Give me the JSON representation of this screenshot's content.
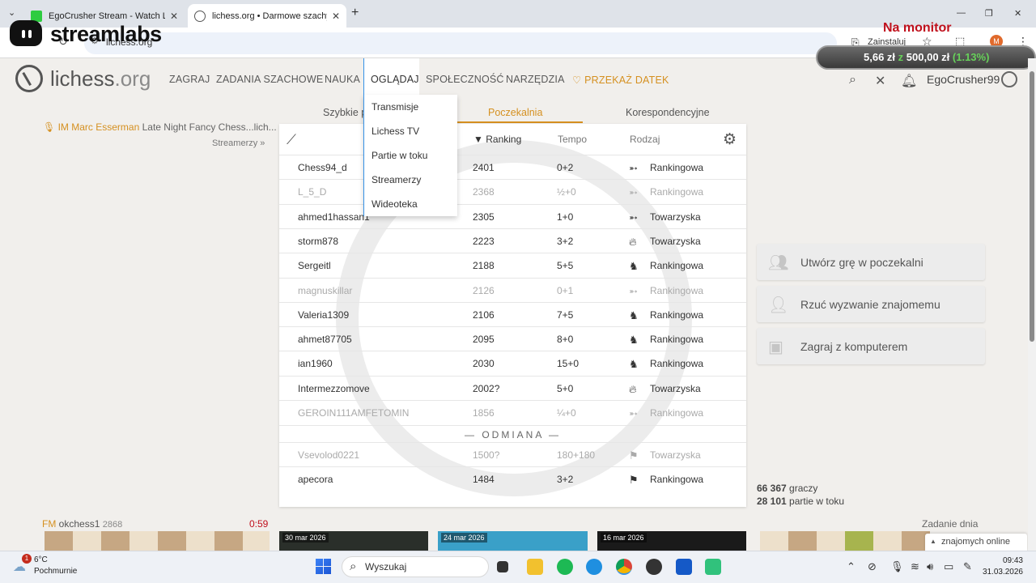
{
  "browser": {
    "tabs": [
      {
        "title": "EgoCrusher Stream - Watch Liv",
        "favicon_color": "#2ecc40"
      },
      {
        "title": "lichess.org • Darmowe szachy o",
        "favicon_color": "#555555"
      }
    ],
    "url": "lichess.org",
    "install_label": "Zainstaluj",
    "profile_initial": "M"
  },
  "overlay": {
    "brand": "streamlabs",
    "monitor_label": "Na monitor",
    "goal_current": "5,66 zł",
    "goal_sep": "z",
    "goal_target": "500,00 zł",
    "goal_percent": "(1.13%)"
  },
  "site": {
    "logo_main": "lichess",
    "logo_suffix": ".org",
    "nav": [
      "ZAGRAJ",
      "ZADANIA SZACHOWE",
      "NAUKA",
      "OGLĄDAJ",
      "SPOŁECZNOŚĆ",
      "NARZĘDZIA"
    ],
    "donate": "PRZEKAŻ DATEK",
    "username": "EgoCrusher99"
  },
  "watch_menu": [
    "Transmisje",
    "Lichess TV",
    "Partie w toku",
    "Streamerzy",
    "Wideoteka"
  ],
  "streamer": {
    "name": "IM Marc Esserman",
    "title": "Late Night Fancy Chess...lich...",
    "link": "Streamerzy »"
  },
  "lobby_tabs": [
    "Szybkie p",
    "Poczekalnia",
    "Korespondencyjne"
  ],
  "lobby": {
    "headers": {
      "rating": "Ranking",
      "time": "Tempo",
      "mode": "Rodzaj"
    },
    "rows": [
      {
        "name": "Chess94_d",
        "rating": "2401",
        "time": "0+2",
        "mode": "Rankingowa",
        "icon": "bullet",
        "dim": false
      },
      {
        "name": "L_5_D",
        "rating": "2368",
        "time": "½+0",
        "mode": "Rankingowa",
        "icon": "bullet",
        "dim": true
      },
      {
        "name": "ahmed1hassan1",
        "rating": "2305",
        "time": "1+0",
        "mode": "Towarzyska",
        "icon": "bullet",
        "dim": false
      },
      {
        "name": "storm878",
        "rating": "2223",
        "time": "3+2",
        "mode": "Towarzyska",
        "icon": "blitz",
        "dim": false
      },
      {
        "name": "Sergeitl",
        "rating": "2188",
        "time": "5+5",
        "mode": "Rankingowa",
        "icon": "rapid",
        "dim": false
      },
      {
        "name": "magnuskillar",
        "rating": "2126",
        "time": "0+1",
        "mode": "Rankingowa",
        "icon": "bullet",
        "dim": true
      },
      {
        "name": "Valeria1309",
        "rating": "2106",
        "time": "7+5",
        "mode": "Rankingowa",
        "icon": "rapid",
        "dim": false
      },
      {
        "name": "ahmet87705",
        "rating": "2095",
        "time": "8+0",
        "mode": "Rankingowa",
        "icon": "rapid",
        "dim": false
      },
      {
        "name": "ian1960",
        "rating": "2030",
        "time": "15+0",
        "mode": "Rankingowa",
        "icon": "rapid",
        "dim": false
      },
      {
        "name": "Intermezzomove",
        "rating": "2002?",
        "time": "5+0",
        "mode": "Towarzyska",
        "icon": "blitz",
        "dim": false
      },
      {
        "name": "GEROIN111AMFETOMIN",
        "rating": "1856",
        "time": "¼+0",
        "mode": "Rankingowa",
        "icon": "bullet",
        "dim": true
      }
    ],
    "separator": "— ODMIANA —",
    "variant_rows": [
      {
        "name": "Vsevolod0221",
        "rating": "1500?",
        "time": "180+180",
        "mode": "Towarzyska",
        "icon": "variant",
        "dim": true
      },
      {
        "name": "apecora",
        "rating": "1484",
        "time": "3+2",
        "mode": "Rankingowa",
        "icon": "variant",
        "dim": false
      }
    ]
  },
  "actions": {
    "create": "Utwórz grę w poczekalni",
    "challenge": "Rzuć wyzwanie znajomemu",
    "computer": "Zagraj z komputerem"
  },
  "counts": {
    "players_num": "66 367",
    "players_label": "graczy",
    "games_num": "28 101",
    "games_label": "partie w toku"
  },
  "bottom": {
    "fm_title": "FM",
    "fm_name": "okchess1",
    "fm_rating": "2868",
    "clock": "0:59",
    "video_dates": [
      "30 mar 2026",
      "24 mar 2026",
      "16 mar 2026"
    ],
    "puzzle": "Zadanie dnia",
    "friends": "znajomych online"
  },
  "taskbar": {
    "temp": "6°C",
    "weather": "Pochmurnie",
    "badge": "1",
    "search": "Wyszukaj",
    "time": "09:43",
    "date": "31.03.2026"
  }
}
